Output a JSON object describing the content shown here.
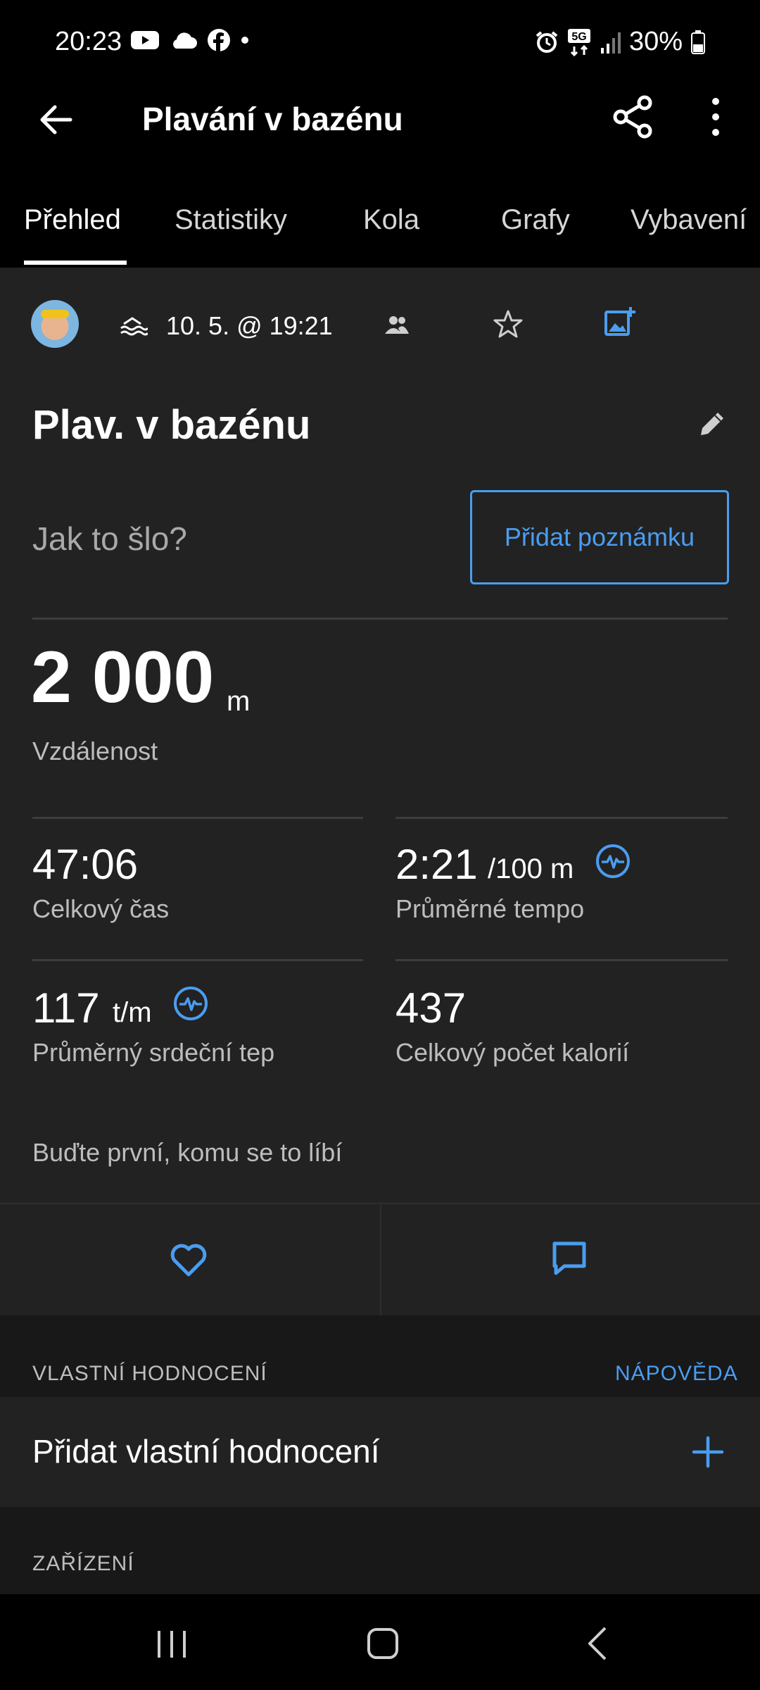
{
  "status_bar": {
    "time": "20:23",
    "battery": "30%",
    "network": "5G"
  },
  "app_bar": {
    "title": "Plavání v bazénu"
  },
  "tabs": [
    {
      "label": "Přehled",
      "active": true
    },
    {
      "label": "Statistiky",
      "active": false
    },
    {
      "label": "Kola",
      "active": false
    },
    {
      "label": "Grafy",
      "active": false
    },
    {
      "label": "Vybavení",
      "active": false
    }
  ],
  "activity": {
    "date": "10. 5. @ 19:21",
    "title": "Plav. v bazénu",
    "prompt": "Jak to šlo?",
    "add_note_label": "Přidat poznámku"
  },
  "distance": {
    "value": "2 000",
    "unit": "m",
    "label": "Vzdálenost"
  },
  "stats": {
    "total_time": {
      "value": "47:06",
      "label": "Celkový čas"
    },
    "avg_pace": {
      "value": "2:21",
      "unit": "/100 m",
      "label": "Průměrné tempo"
    },
    "avg_hr": {
      "value": "117",
      "unit": "t/m",
      "label": "Průměrný srdeční tep"
    },
    "calories": {
      "value": "437",
      "label": "Celkový počet kalorií"
    }
  },
  "social": {
    "likes_text": "Buďte první, komu se to líbí"
  },
  "self_evaluation": {
    "header": "VLASTNÍ HODNOCENÍ",
    "help": "NÁPOVĚDA",
    "add_label": "Přidat vlastní hodnocení"
  },
  "device": {
    "header": "ZAŘÍZENÍ"
  },
  "colors": {
    "accent": "#4a9df0",
    "background": "#222222",
    "bar": "#000000"
  }
}
